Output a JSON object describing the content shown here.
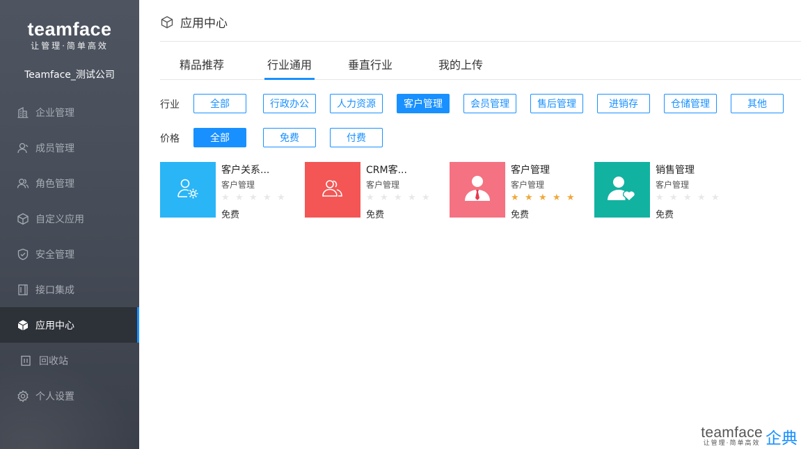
{
  "sidebar": {
    "logo_word": "teamface",
    "logo_slogan": "让管理·简单高效",
    "company": "Teamface_测试公司",
    "items": [
      {
        "label": "企业管理",
        "icon": "building-icon"
      },
      {
        "label": "成员管理",
        "icon": "person-icon"
      },
      {
        "label": "角色管理",
        "icon": "people-icon"
      },
      {
        "label": "自定义应用",
        "icon": "cube-icon"
      },
      {
        "label": "安全管理",
        "icon": "shield-icon"
      },
      {
        "label": "接口集成",
        "icon": "interface-icon"
      },
      {
        "label": "应用中心",
        "icon": "cube-icon",
        "active": true
      },
      {
        "label": "回收站",
        "icon": "trash-icon"
      },
      {
        "label": "个人设置",
        "icon": "gear-icon"
      }
    ]
  },
  "header": {
    "title": "应用中心",
    "icon": "cube-icon"
  },
  "tabs": [
    {
      "label": "精品推荐"
    },
    {
      "label": "行业通用",
      "active": true
    },
    {
      "label": "垂直行业"
    },
    {
      "label": "我的上传"
    }
  ],
  "filters": {
    "industry_label": "行业",
    "industry": [
      "全部",
      "行政办公",
      "人力资源",
      "客户管理",
      "会员管理",
      "售后管理",
      "进销存",
      "仓储管理",
      "其他"
    ],
    "industry_selected": "客户管理",
    "price_label": "价格",
    "price": [
      "全部",
      "免费",
      "付费"
    ],
    "price_selected": "全部"
  },
  "apps": [
    {
      "name": "客户关系...",
      "category": "客户管理",
      "rating": 0,
      "price": "免费",
      "color": "#2ab5f6",
      "icon": "user-settings-icon"
    },
    {
      "name": "CRM客...",
      "category": "客户管理",
      "rating": 0,
      "price": "免费",
      "color": "#f35654",
      "icon": "group-icon"
    },
    {
      "name": "客户管理",
      "category": "客户管理",
      "rating": 5,
      "price": "免费",
      "color": "#f47281",
      "icon": "businessman-icon"
    },
    {
      "name": "销售管理",
      "category": "客户管理",
      "rating": 0,
      "price": "免费",
      "color": "#12b2a1",
      "icon": "user-heart-icon"
    }
  ],
  "brand": {
    "word": "teamface",
    "slogan": "让管理·简单高效",
    "cn": "企典"
  },
  "colors": {
    "accent": "#1890ff",
    "sidebar": "#4b525d",
    "star": "#f1a83a"
  }
}
